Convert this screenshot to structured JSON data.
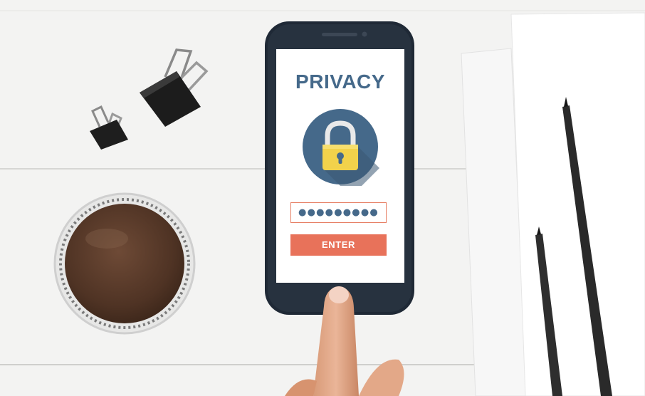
{
  "screen": {
    "title": "PRIVACY",
    "password_mask": "●●●●●●●●●",
    "enter_label": "ENTER",
    "lock_icon": "padlock-icon"
  },
  "colors": {
    "title_blue": "#45698a",
    "accent_coral": "#e8725a",
    "lock_circle": "#45698a",
    "lock_body": "#f2d24b"
  }
}
